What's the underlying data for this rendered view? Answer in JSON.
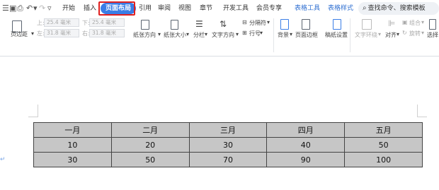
{
  "tabs": {
    "home": "开始",
    "insert": "插入",
    "page_layout": "页面布局",
    "references": "引用",
    "review": "审阅",
    "view": "视图",
    "section": "章节",
    "developer": "开发工具",
    "member": "会员专享",
    "table_tools": "表格工具",
    "table_style": "表格样式"
  },
  "search": {
    "label": "查找命令、搜索模板"
  },
  "ribbon": {
    "margins": "页边距",
    "top_label": "上:",
    "top_value": "25.4 毫米",
    "bottom_label": "下:",
    "bottom_value": "25.4 毫米",
    "left_label": "左:",
    "left_value": "31.8 毫米",
    "right_label": "右:",
    "right_value": "31.8 毫米",
    "orientation": "纸张方向",
    "size": "纸张大小",
    "columns": "分栏",
    "text_direction": "文字方向",
    "breaks": "分隔符",
    "line_numbers": "行号",
    "background": "背景",
    "page_border": "页面边框",
    "paper_settings": "稿纸设置",
    "text_wrap": "文字环绕",
    "align": "对齐",
    "group": "组合",
    "rotate": "旋转",
    "select": "选择"
  },
  "table": {
    "headers": [
      "一月",
      "二月",
      "三月",
      "四月",
      "五月"
    ],
    "rows": [
      [
        "10",
        "20",
        "30",
        "40",
        "50"
      ],
      [
        "30",
        "50",
        "70",
        "90",
        "100"
      ]
    ]
  }
}
